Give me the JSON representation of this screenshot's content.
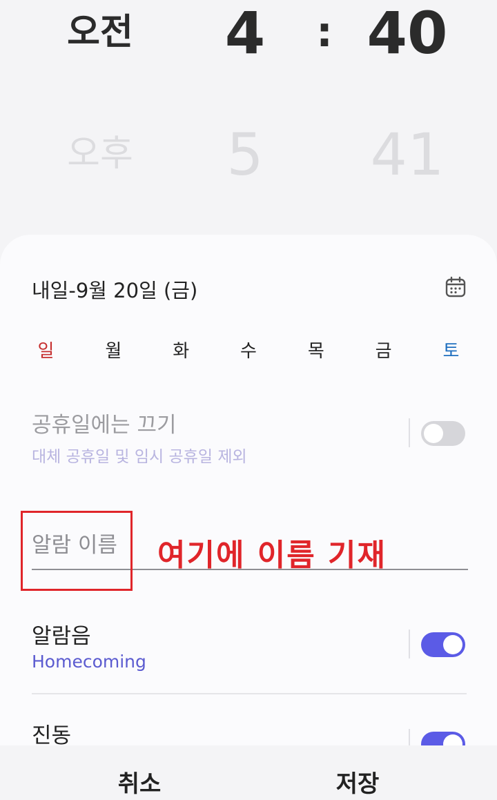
{
  "time_picker": {
    "selected": {
      "ampm": "오전",
      "hour": "4",
      "separator": ":",
      "minute": "40"
    },
    "next": {
      "ampm": "오후",
      "hour": "5",
      "minute": "41"
    }
  },
  "schedule": {
    "date_label": "내일-9월 20일 (금)",
    "calendar_icon": "calendar-icon",
    "days": [
      "일",
      "월",
      "화",
      "수",
      "목",
      "금",
      "토"
    ]
  },
  "holiday": {
    "title": "공휴일에는 끄기",
    "subtitle": "대체 공휴일 및 임시 공휴일 제외",
    "enabled": false
  },
  "alarm_name": {
    "placeholder": "알람 이름",
    "value": ""
  },
  "annotation": {
    "text": "여기에 이름 기재",
    "color": "#e0252a"
  },
  "alarm_sound": {
    "title": "알람음",
    "value": "Homecoming",
    "enabled": true
  },
  "vibration": {
    "title": "진동",
    "enabled": true
  },
  "footer": {
    "cancel_label": "취소",
    "save_label": "저장"
  },
  "colors": {
    "accent": "#5b5be6",
    "sunday": "#c62f2f",
    "saturday": "#1f6fbf"
  }
}
